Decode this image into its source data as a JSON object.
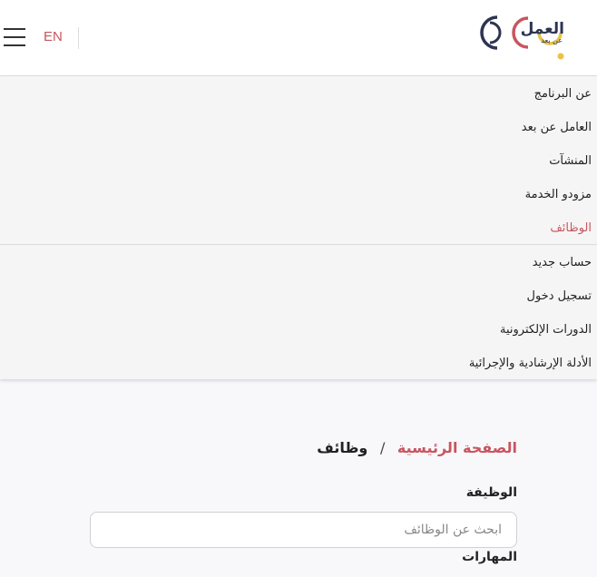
{
  "header": {
    "lang_label": "EN",
    "logo_text": "العمل",
    "logo_subtext": "عن بعد",
    "colors": {
      "navy": "#2d3452",
      "accent": "#c8555f",
      "gold": "#e8c24a"
    }
  },
  "menu": {
    "items": [
      {
        "label": "عن البرنامج",
        "active": false
      },
      {
        "label": "العامل عن بعد",
        "active": false
      },
      {
        "label": "المنشآت",
        "active": false
      },
      {
        "label": "مزودو الخدمة",
        "active": false
      },
      {
        "label": "الوظائف",
        "active": true
      },
      {
        "label": "حساب جديد",
        "active": false
      },
      {
        "label": "تسجيل دخول",
        "active": false
      },
      {
        "label": "الدورات الإلكترونية",
        "active": false
      },
      {
        "label": "الأدلة الإرشادية والإجرائية",
        "active": false
      }
    ]
  },
  "breadcrumb": {
    "home": "الصفحة الرئيسية",
    "separator": "/",
    "current": "وظائف"
  },
  "filters": {
    "job_label": "الوظيفة",
    "job_placeholder": "ابحث عن الوظائف",
    "skills_label": "المهارات"
  }
}
